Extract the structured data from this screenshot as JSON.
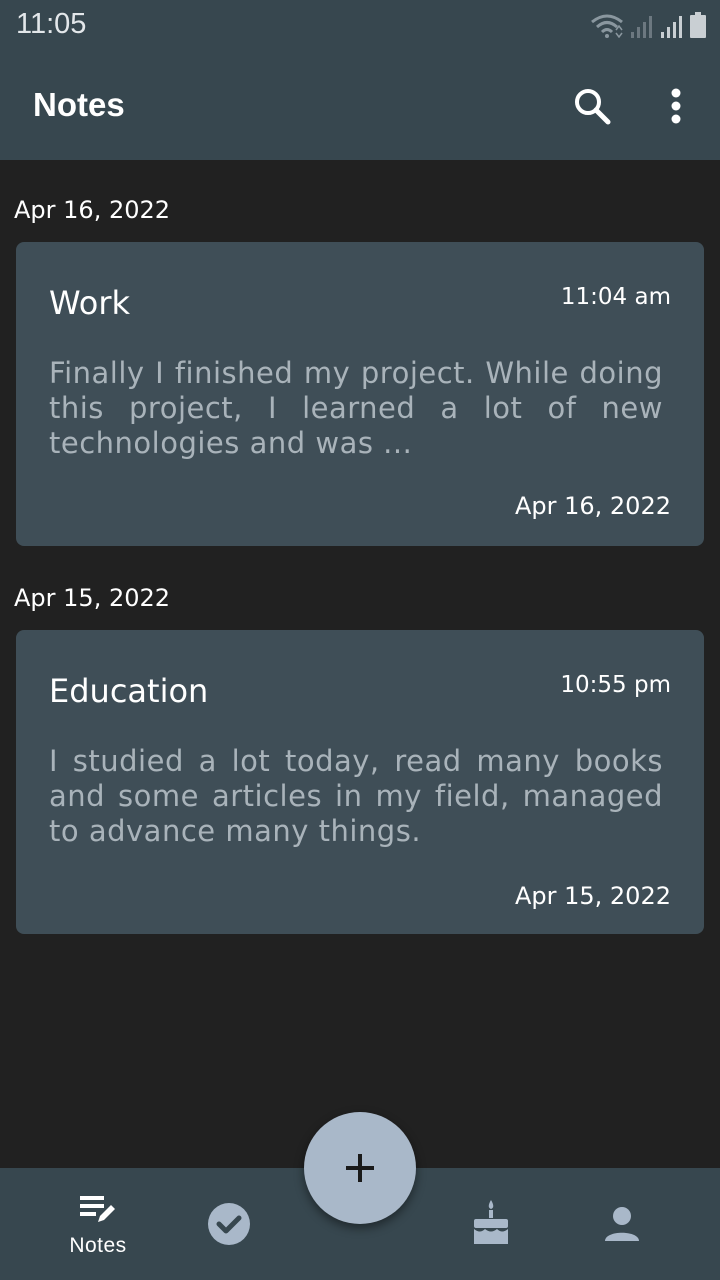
{
  "status_bar": {
    "time": "11:05"
  },
  "app_bar": {
    "title": "Notes"
  },
  "sections": [
    {
      "date": "Apr 16, 2022",
      "note": {
        "title": "Work",
        "time": "11:04 am",
        "body": "Finally I finished my project. While doing this project, I learned a lot of new technologies and was ...",
        "date": "Apr 16, 2022"
      }
    },
    {
      "date": "Apr 15, 2022",
      "note": {
        "title": "Education",
        "time": "10:55 pm",
        "body": "I studied a lot today, read many books and some articles in my field, managed to advance many things.",
        "date": "Apr 15, 2022"
      }
    }
  ],
  "bottom_nav": {
    "items": [
      {
        "label": "Notes",
        "icon": "notes-edit-icon",
        "active": true
      },
      {
        "label": "",
        "icon": "check-circle-icon",
        "active": false
      },
      {
        "label": "",
        "icon": "cake-icon",
        "active": false
      },
      {
        "label": "",
        "icon": "person-icon",
        "active": false
      }
    ]
  },
  "fab": {
    "icon": "plus-icon"
  },
  "colors": {
    "background": "#212121",
    "app_bar": "#37474f",
    "card": "#3f4e57",
    "body_text": "#a9b3ba",
    "fab": "#a9b8c9",
    "inactive_icon": "#a9b8c9"
  }
}
